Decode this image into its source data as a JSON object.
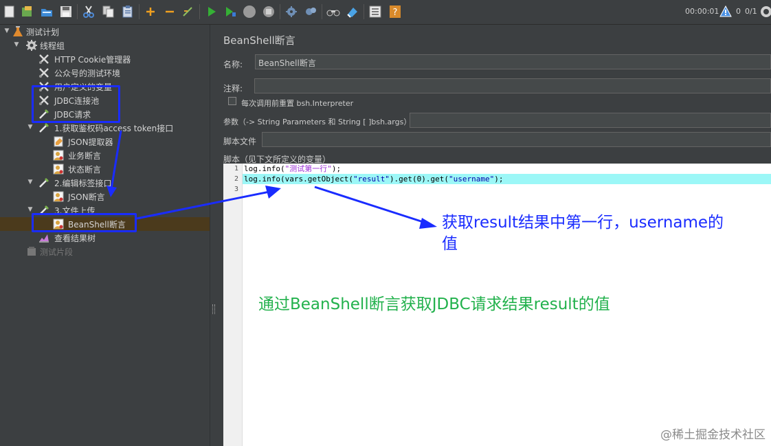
{
  "toolbar": {
    "buttons": [
      {
        "name": "new-icon"
      },
      {
        "name": "templates-icon"
      },
      {
        "name": "open-icon"
      },
      {
        "name": "save-icon"
      },
      {
        "name": "cut-icon"
      },
      {
        "name": "copy-icon"
      },
      {
        "name": "paste-icon"
      },
      {
        "name": "expand-icon"
      },
      {
        "name": "collapse-icon"
      },
      {
        "name": "toggle-icon"
      },
      {
        "name": "start-icon"
      },
      {
        "name": "start-no-pauses-icon"
      },
      {
        "name": "stop-icon"
      },
      {
        "name": "shutdown-icon"
      },
      {
        "name": "clear-icon"
      },
      {
        "name": "clear-all-icon"
      },
      {
        "name": "search-icon"
      },
      {
        "name": "reset-search-icon"
      },
      {
        "name": "function-helper-icon"
      },
      {
        "name": "help-icon"
      }
    ],
    "elapsed_time": "00:00:01",
    "warning_count": "0",
    "threads": "0/1"
  },
  "tree": {
    "items": [
      {
        "label": "测试计划",
        "icon": "test-plan-icon",
        "toggle": "▼",
        "level": 0
      },
      {
        "label": "线程组",
        "icon": "thread-group-icon",
        "toggle": "▼",
        "level": 1
      },
      {
        "label": "HTTP Cookie管理器",
        "icon": "config-element-icon",
        "toggle": "",
        "level": 2
      },
      {
        "label": "公众号的测试环境",
        "icon": "config-element-icon",
        "toggle": "",
        "level": 2
      },
      {
        "label": "用户定义的变量",
        "icon": "config-element-icon",
        "toggle": "",
        "level": 2
      },
      {
        "label": "JDBC连接池",
        "icon": "config-element-icon",
        "toggle": "",
        "level": 2
      },
      {
        "label": "JDBC请求",
        "icon": "sampler-icon",
        "toggle": "",
        "level": 2
      },
      {
        "label": "1.获取鉴权码access token接口",
        "icon": "sampler-icon",
        "toggle": "▼",
        "level": 2
      },
      {
        "label": "JSON提取器",
        "icon": "extractor-icon",
        "toggle": "",
        "level": 3
      },
      {
        "label": "业务断言",
        "icon": "assertion-icon",
        "toggle": "",
        "level": 3
      },
      {
        "label": "状态断言",
        "icon": "assertion-icon",
        "toggle": "",
        "level": 3
      },
      {
        "label": "2.编辑标签接口",
        "icon": "sampler-icon",
        "toggle": "▼",
        "level": 2
      },
      {
        "label": "JSON断言",
        "icon": "assertion-icon",
        "toggle": "",
        "level": 3
      },
      {
        "label": "3.文件上传",
        "icon": "sampler-icon",
        "toggle": "▼",
        "level": 2
      },
      {
        "label": "BeanShell断言",
        "icon": "assertion-icon",
        "toggle": "",
        "level": 3,
        "selected": true
      },
      {
        "label": "查看结果树",
        "icon": "listener-icon",
        "toggle": "",
        "level": 2
      },
      {
        "label": "测试片段",
        "icon": "test-fragment-icon",
        "toggle": "",
        "level": 1,
        "disabled": true
      }
    ]
  },
  "panel": {
    "title": "BeanShell断言",
    "name_label": "名称:",
    "name_value": "BeanShell断言",
    "comment_label": "注释:",
    "comment_value": "",
    "reset_label": "每次调用前重置 bsh.Interpreter",
    "params_label": "参数（-> String Parameters 和 String [ ]bsh.args）",
    "params_value": "",
    "script_file_label": "脚本文件",
    "script_file_value": "",
    "script_label": "脚本（见下文所定义的变量）"
  },
  "editor": {
    "line_numbers": [
      "1",
      "2",
      "3"
    ],
    "lines": [
      {
        "pre": "log.info(",
        "str": "\"测试第一行\"",
        "post": ");"
      },
      {
        "pre": "log.info(vars.getObject(",
        "str": "\"result\"",
        "mid": ").get(0).get(",
        "str2": "\"username\"",
        "post": ");"
      },
      {
        "pre": "",
        "str": "",
        "post": ""
      }
    ]
  },
  "annotations": {
    "blue_note": "获取result结果中第一行，username的值",
    "green_note": "通过BeanShell断言获取JDBC请求结果result的值",
    "arrow_color": "#1a2cff",
    "green_color": "#22b14c"
  },
  "watermark": "@稀土掘金技术社区"
}
